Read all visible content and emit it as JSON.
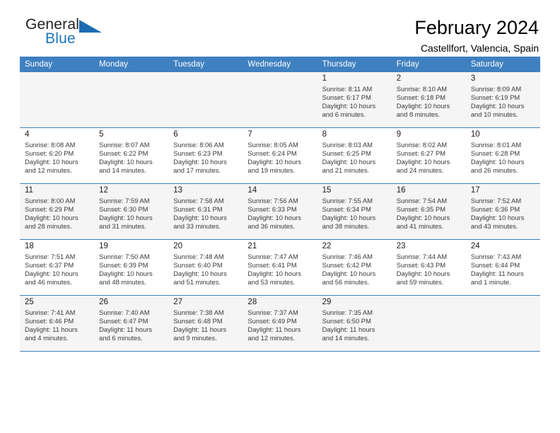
{
  "brand": {
    "name_top": "General",
    "name_bottom": "Blue",
    "accent_color": "#1b75bb",
    "triangle_color": "#1b6cb0"
  },
  "header": {
    "title": "February 2024",
    "subtitle": "Castellfort, Valencia, Spain",
    "header_bg_color": "#3f80c0",
    "header_text_color": "#ffffff"
  },
  "weekday_headers": [
    "Sunday",
    "Monday",
    "Tuesday",
    "Wednesday",
    "Thursday",
    "Friday",
    "Saturday"
  ],
  "weeks": [
    [
      {
        "day": "",
        "sunrise": "",
        "sunset": "",
        "daylight_1": "",
        "daylight_2": "",
        "empty": true
      },
      {
        "day": "",
        "sunrise": "",
        "sunset": "",
        "daylight_1": "",
        "daylight_2": "",
        "empty": true
      },
      {
        "day": "",
        "sunrise": "",
        "sunset": "",
        "daylight_1": "",
        "daylight_2": "",
        "empty": true
      },
      {
        "day": "",
        "sunrise": "",
        "sunset": "",
        "daylight_1": "",
        "daylight_2": "",
        "empty": true
      },
      {
        "day": "1",
        "sunrise": "Sunrise: 8:11 AM",
        "sunset": "Sunset: 6:17 PM",
        "daylight_1": "Daylight: 10 hours",
        "daylight_2": "and 6 minutes."
      },
      {
        "day": "2",
        "sunrise": "Sunrise: 8:10 AM",
        "sunset": "Sunset: 6:18 PM",
        "daylight_1": "Daylight: 10 hours",
        "daylight_2": "and 8 minutes."
      },
      {
        "day": "3",
        "sunrise": "Sunrise: 8:09 AM",
        "sunset": "Sunset: 6:19 PM",
        "daylight_1": "Daylight: 10 hours",
        "daylight_2": "and 10 minutes."
      }
    ],
    [
      {
        "day": "4",
        "sunrise": "Sunrise: 8:08 AM",
        "sunset": "Sunset: 6:20 PM",
        "daylight_1": "Daylight: 10 hours",
        "daylight_2": "and 12 minutes."
      },
      {
        "day": "5",
        "sunrise": "Sunrise: 8:07 AM",
        "sunset": "Sunset: 6:22 PM",
        "daylight_1": "Daylight: 10 hours",
        "daylight_2": "and 14 minutes."
      },
      {
        "day": "6",
        "sunrise": "Sunrise: 8:06 AM",
        "sunset": "Sunset: 6:23 PM",
        "daylight_1": "Daylight: 10 hours",
        "daylight_2": "and 17 minutes."
      },
      {
        "day": "7",
        "sunrise": "Sunrise: 8:05 AM",
        "sunset": "Sunset: 6:24 PM",
        "daylight_1": "Daylight: 10 hours",
        "daylight_2": "and 19 minutes."
      },
      {
        "day": "8",
        "sunrise": "Sunrise: 8:03 AM",
        "sunset": "Sunset: 6:25 PM",
        "daylight_1": "Daylight: 10 hours",
        "daylight_2": "and 21 minutes."
      },
      {
        "day": "9",
        "sunrise": "Sunrise: 8:02 AM",
        "sunset": "Sunset: 6:27 PM",
        "daylight_1": "Daylight: 10 hours",
        "daylight_2": "and 24 minutes."
      },
      {
        "day": "10",
        "sunrise": "Sunrise: 8:01 AM",
        "sunset": "Sunset: 6:28 PM",
        "daylight_1": "Daylight: 10 hours",
        "daylight_2": "and 26 minutes."
      }
    ],
    [
      {
        "day": "11",
        "sunrise": "Sunrise: 8:00 AM",
        "sunset": "Sunset: 6:29 PM",
        "daylight_1": "Daylight: 10 hours",
        "daylight_2": "and 28 minutes."
      },
      {
        "day": "12",
        "sunrise": "Sunrise: 7:59 AM",
        "sunset": "Sunset: 6:30 PM",
        "daylight_1": "Daylight: 10 hours",
        "daylight_2": "and 31 minutes."
      },
      {
        "day": "13",
        "sunrise": "Sunrise: 7:58 AM",
        "sunset": "Sunset: 6:31 PM",
        "daylight_1": "Daylight: 10 hours",
        "daylight_2": "and 33 minutes."
      },
      {
        "day": "14",
        "sunrise": "Sunrise: 7:56 AM",
        "sunset": "Sunset: 6:33 PM",
        "daylight_1": "Daylight: 10 hours",
        "daylight_2": "and 36 minutes."
      },
      {
        "day": "15",
        "sunrise": "Sunrise: 7:55 AM",
        "sunset": "Sunset: 6:34 PM",
        "daylight_1": "Daylight: 10 hours",
        "daylight_2": "and 38 minutes."
      },
      {
        "day": "16",
        "sunrise": "Sunrise: 7:54 AM",
        "sunset": "Sunset: 6:35 PM",
        "daylight_1": "Daylight: 10 hours",
        "daylight_2": "and 41 minutes."
      },
      {
        "day": "17",
        "sunrise": "Sunrise: 7:52 AM",
        "sunset": "Sunset: 6:36 PM",
        "daylight_1": "Daylight: 10 hours",
        "daylight_2": "and 43 minutes."
      }
    ],
    [
      {
        "day": "18",
        "sunrise": "Sunrise: 7:51 AM",
        "sunset": "Sunset: 6:37 PM",
        "daylight_1": "Daylight: 10 hours",
        "daylight_2": "and 46 minutes."
      },
      {
        "day": "19",
        "sunrise": "Sunrise: 7:50 AM",
        "sunset": "Sunset: 6:39 PM",
        "daylight_1": "Daylight: 10 hours",
        "daylight_2": "and 48 minutes."
      },
      {
        "day": "20",
        "sunrise": "Sunrise: 7:48 AM",
        "sunset": "Sunset: 6:40 PM",
        "daylight_1": "Daylight: 10 hours",
        "daylight_2": "and 51 minutes."
      },
      {
        "day": "21",
        "sunrise": "Sunrise: 7:47 AM",
        "sunset": "Sunset: 6:41 PM",
        "daylight_1": "Daylight: 10 hours",
        "daylight_2": "and 53 minutes."
      },
      {
        "day": "22",
        "sunrise": "Sunrise: 7:46 AM",
        "sunset": "Sunset: 6:42 PM",
        "daylight_1": "Daylight: 10 hours",
        "daylight_2": "and 56 minutes."
      },
      {
        "day": "23",
        "sunrise": "Sunrise: 7:44 AM",
        "sunset": "Sunset: 6:43 PM",
        "daylight_1": "Daylight: 10 hours",
        "daylight_2": "and 59 minutes."
      },
      {
        "day": "24",
        "sunrise": "Sunrise: 7:43 AM",
        "sunset": "Sunset: 6:44 PM",
        "daylight_1": "Daylight: 11 hours",
        "daylight_2": "and 1 minute."
      }
    ],
    [
      {
        "day": "25",
        "sunrise": "Sunrise: 7:41 AM",
        "sunset": "Sunset: 6:46 PM",
        "daylight_1": "Daylight: 11 hours",
        "daylight_2": "and 4 minutes."
      },
      {
        "day": "26",
        "sunrise": "Sunrise: 7:40 AM",
        "sunset": "Sunset: 6:47 PM",
        "daylight_1": "Daylight: 11 hours",
        "daylight_2": "and 6 minutes."
      },
      {
        "day": "27",
        "sunrise": "Sunrise: 7:38 AM",
        "sunset": "Sunset: 6:48 PM",
        "daylight_1": "Daylight: 11 hours",
        "daylight_2": "and 9 minutes."
      },
      {
        "day": "28",
        "sunrise": "Sunrise: 7:37 AM",
        "sunset": "Sunset: 6:49 PM",
        "daylight_1": "Daylight: 11 hours",
        "daylight_2": "and 12 minutes."
      },
      {
        "day": "29",
        "sunrise": "Sunrise: 7:35 AM",
        "sunset": "Sunset: 6:50 PM",
        "daylight_1": "Daylight: 11 hours",
        "daylight_2": "and 14 minutes."
      },
      {
        "day": "",
        "sunrise": "",
        "sunset": "",
        "daylight_1": "",
        "daylight_2": "",
        "empty": true
      },
      {
        "day": "",
        "sunrise": "",
        "sunset": "",
        "daylight_1": "",
        "daylight_2": "",
        "empty": true
      }
    ]
  ]
}
